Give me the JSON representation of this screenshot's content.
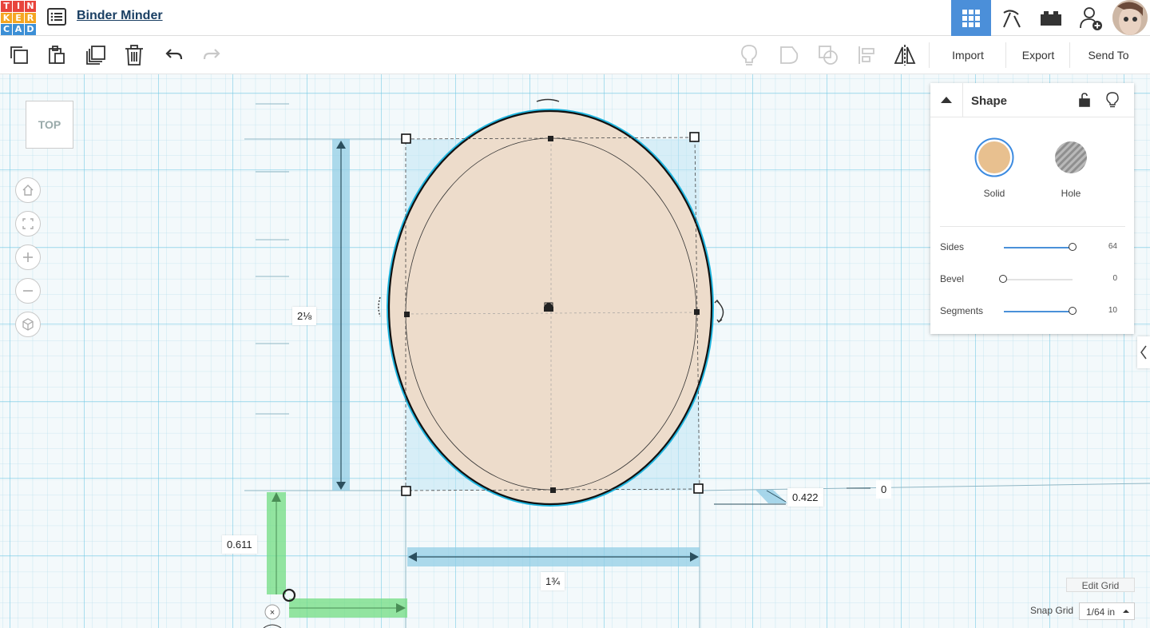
{
  "app": {
    "logo_letters": [
      "T",
      "I",
      "N",
      "K",
      "E",
      "R",
      "C",
      "A",
      "D"
    ],
    "logo_colors": [
      "#e8453c",
      "#e8453c",
      "#e8453c",
      "#f5a623",
      "#f5a623",
      "#f5a623",
      "#3c8fd6",
      "#3c8fd6",
      "#3c8fd6"
    ],
    "design_title": "Binder Minder",
    "accent": "#4b8fd9"
  },
  "topbar": {
    "icons": [
      "design-list-icon",
      "3d-view-grid-icon",
      "codeblocks-pickaxe-icon",
      "bricks-icon",
      "add-user-icon",
      "avatar"
    ]
  },
  "toolbar": {
    "tools": [
      "copy-icon",
      "paste-icon",
      "duplicate-icon",
      "delete-icon",
      "undo-icon",
      "redo-icon"
    ],
    "right_tools": [
      "notes-lightbulb-icon",
      "group-icon",
      "ungroup-icon",
      "align-icon",
      "mirror-icon"
    ],
    "import_label": "Import",
    "export_label": "Export",
    "send_to_label": "Send To"
  },
  "viewport": {
    "viewcube_label": "TOP",
    "nav_buttons": [
      "home-icon",
      "fit-view-icon",
      "zoom-in-icon",
      "zoom-out-icon",
      "perspective-icon"
    ]
  },
  "selection": {
    "height_label": "2⅛",
    "width_label": "1¾",
    "elevation_label": "0.422",
    "z_label": "0",
    "y_offset_label": "0.611",
    "shape_color": "#eddccb",
    "outline_color": "#1fb6e0"
  },
  "inspector": {
    "title": "Shape",
    "solid_label": "Solid",
    "hole_label": "Hole",
    "solid_color": "#e8c08f",
    "properties": [
      {
        "label": "Sides",
        "value": "64",
        "fraction": 1.0
      },
      {
        "label": "Bevel",
        "value": "0",
        "fraction": 0.0
      },
      {
        "label": "Segments",
        "value": "10",
        "fraction": 1.0
      }
    ]
  },
  "grid_panel": {
    "edit_grid_label": "Edit Grid",
    "snap_grid_label": "Snap Grid",
    "snap_grid_value": "1/64 in"
  }
}
